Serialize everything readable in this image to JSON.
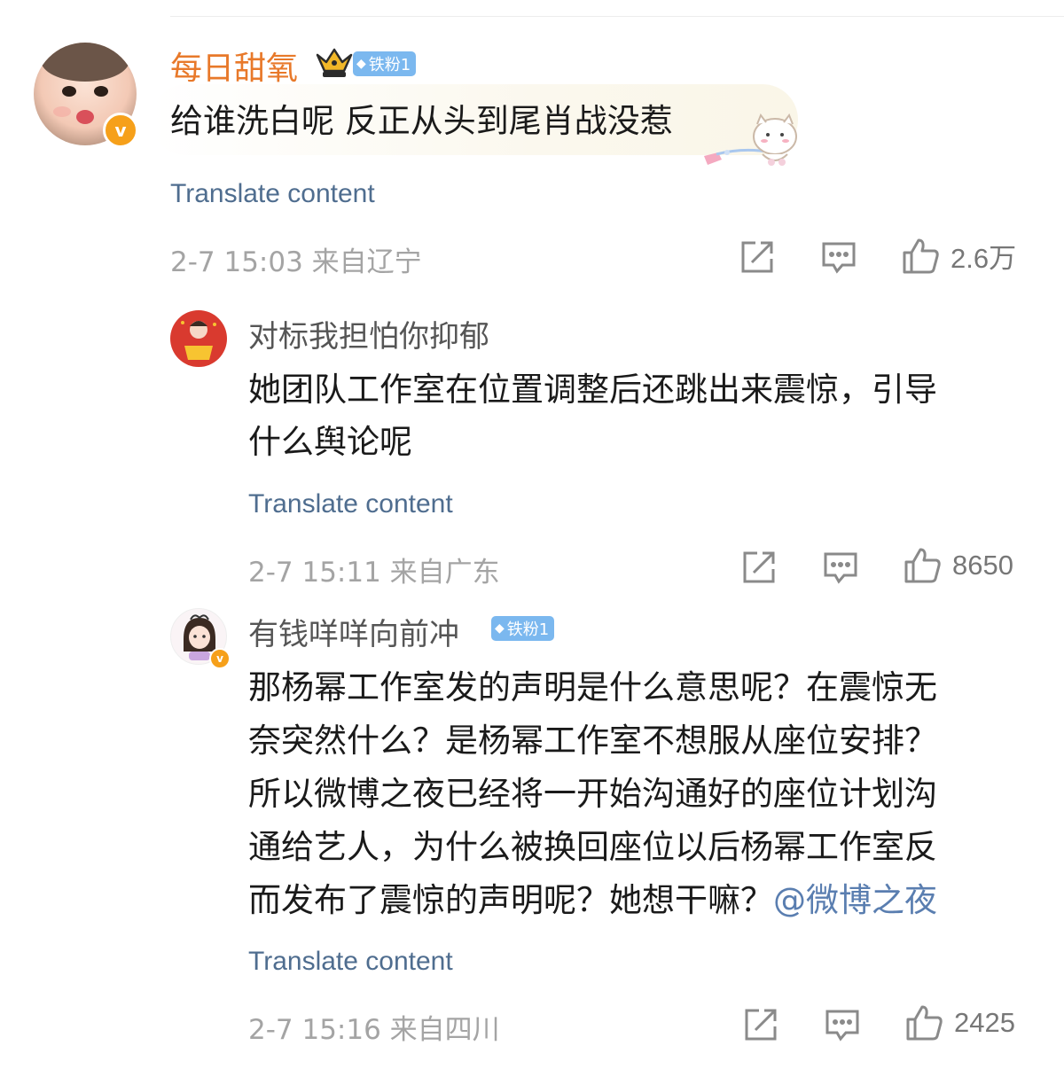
{
  "comments": [
    {
      "username": "每日甜氧",
      "fan_badge": "铁粉1",
      "text": "给谁洗白呢 反正从头到尾肖战没惹",
      "translate": "Translate content",
      "meta": "2-7 15:03 来自辽宁",
      "likes": "2.6万"
    },
    {
      "username": "对标我担怕你抑郁",
      "text": "她团队工作室在位置调整后还跳出来震惊，引导\n什么舆论呢",
      "translate": "Translate content",
      "meta": "2-7 15:11 来自广东",
      "likes": "8650"
    },
    {
      "username": "有钱咩咩向前冲",
      "fan_badge": "铁粉1",
      "text": "那杨幂工作室发的声明是什么意思呢？在震惊无\n奈突然什么？是杨幂工作室不想服从座位安排？\n所以微博之夜已经将一开始沟通好的座位计划沟\n通给艺人，为什么被换回座位以后杨幂工作室反\n而发布了震惊的声明呢？她想干嘛？",
      "mention": "@微博之夜",
      "translate": "Translate content",
      "meta": "2-7 15:16 来自四川",
      "likes": "2425"
    }
  ],
  "colors": {
    "accent_orange": "#e8792a",
    "link_blue": "#5a7eb0",
    "meta_gray": "#a4a4a4",
    "verified": "#f6a01a",
    "fan_badge": "#7bb8ef"
  },
  "icons": [
    "share-icon",
    "comment-icon",
    "like-icon",
    "verified-icon",
    "crown-icon",
    "diamond-icon"
  ]
}
